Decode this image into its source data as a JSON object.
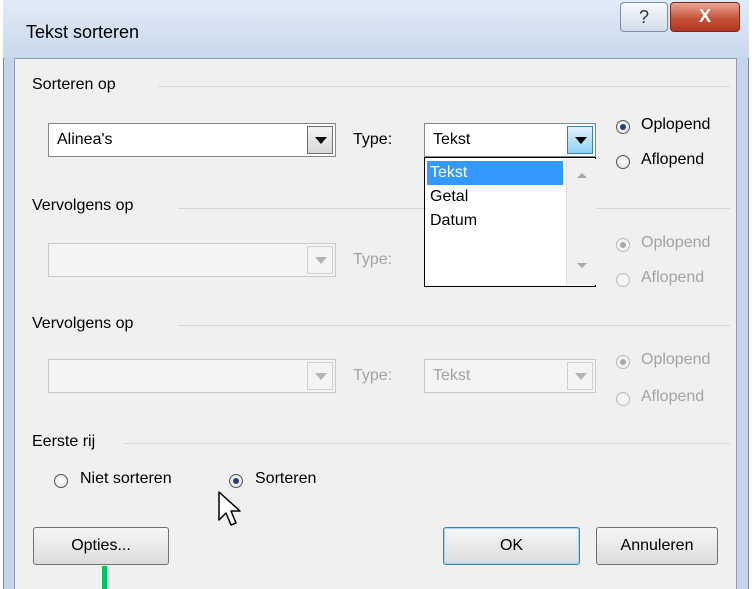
{
  "window": {
    "title": "Tekst sorteren",
    "help_label": "?",
    "close_label": "X"
  },
  "sections": [
    {
      "label": "Sorteren op",
      "field_value": "Alinea's",
      "type_label": "Type:",
      "type_value": "Tekst",
      "ascending_label": "Oplopend",
      "descending_label": "Aflopend",
      "selected": "ascending"
    },
    {
      "label": "Vervolgens op",
      "field_value": "",
      "type_label": "Type:",
      "type_value": "",
      "ascending_label": "Oplopend",
      "descending_label": "Aflopend",
      "selected": "ascending"
    },
    {
      "label": "Vervolgens op",
      "field_value": "",
      "type_label": "Type:",
      "type_value": "Tekst",
      "ascending_label": "Oplopend",
      "descending_label": "Aflopend",
      "selected": "ascending"
    }
  ],
  "type_dropdown": {
    "options": [
      "Tekst",
      "Getal",
      "Datum"
    ],
    "selected": "Tekst"
  },
  "first_row": {
    "label": "Eerste rij",
    "no_sort_label": "Niet sorteren",
    "sort_label": "Sorteren",
    "selected": "sort"
  },
  "buttons": {
    "options_label": "Opties...",
    "ok_label": "OK",
    "cancel_label": "Annuleren"
  },
  "colors": {
    "selection": "#3399ff",
    "window_frame": "#c5d5ea",
    "close_button": "#c4533b",
    "annotation_marker": "#00c060"
  }
}
